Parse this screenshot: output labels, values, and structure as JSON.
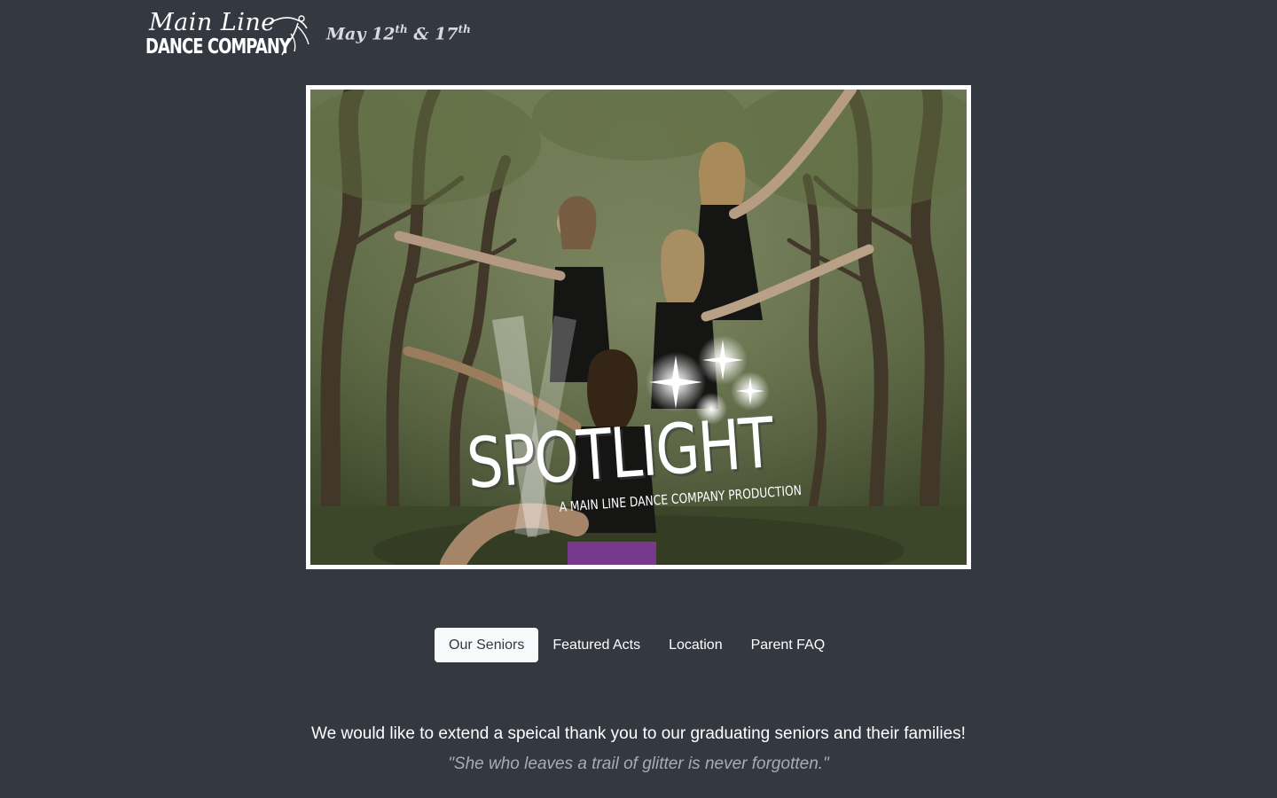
{
  "header": {
    "logo_script": "Main Line",
    "logo_block": "DANCE COMPANY",
    "dates": {
      "first_day": "May 12",
      "first_suffix": "th",
      "joiner": " & 17",
      "second_suffix": "th"
    }
  },
  "hero": {
    "title": "SPOTLIGHT",
    "subtitle": "A MAIN LINE DANCE COMPANY PRODUCTION",
    "icon": "sparkle-icon"
  },
  "tabs": [
    {
      "label": "Our Seniors",
      "active": true
    },
    {
      "label": "Featured Acts",
      "active": false
    },
    {
      "label": "Location",
      "active": false
    },
    {
      "label": "Parent FAQ",
      "active": false
    }
  ],
  "content": {
    "thanks": "We would like to extend a speical thank you to our graduating seniors and their families!",
    "quote": "\"She who leaves a trail of glitter is never forgotten.\""
  },
  "colors": {
    "background": "#343841",
    "active_tab_bg": "#f8f9fa",
    "quote_text": "#a9acb3"
  }
}
